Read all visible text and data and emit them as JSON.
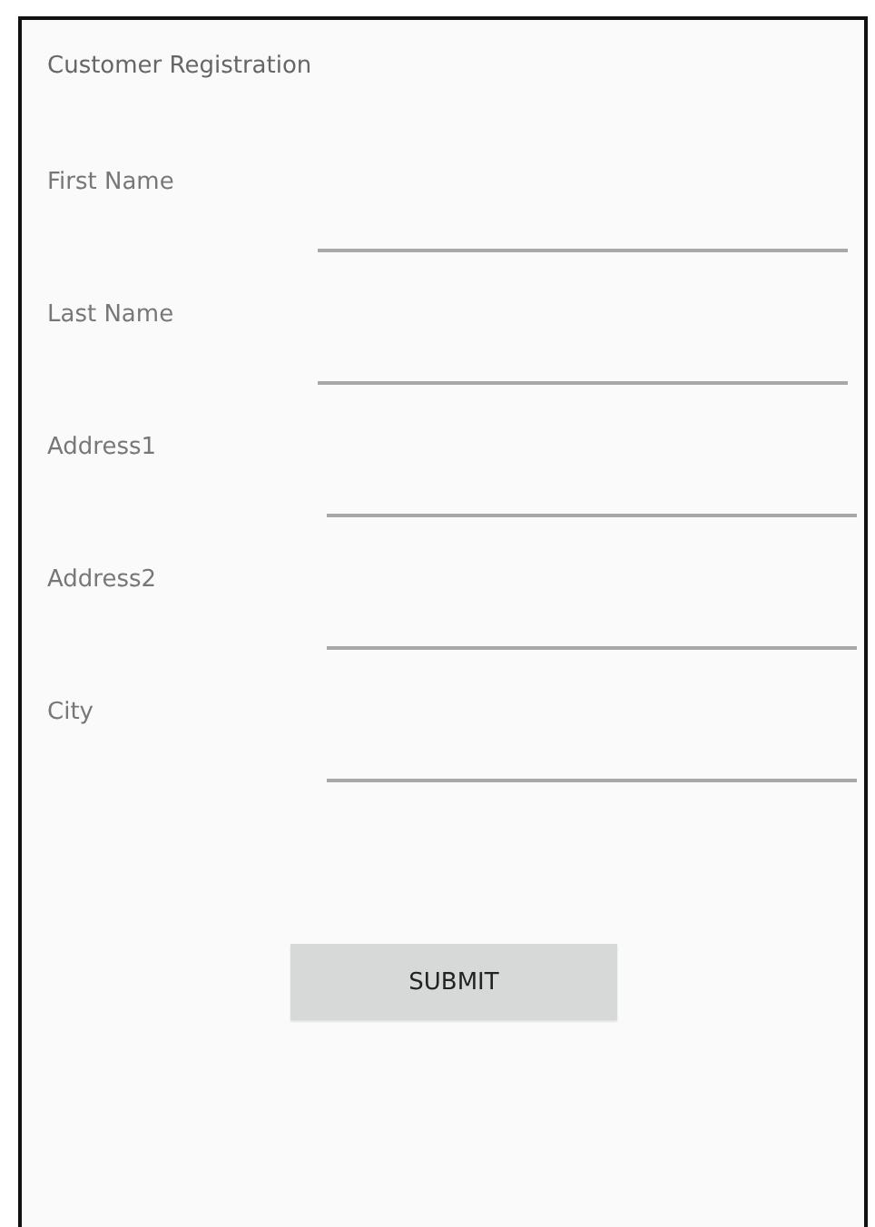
{
  "title": "Customer Registration",
  "fields": [
    {
      "label": "First Name"
    },
    {
      "label": "Last Name"
    },
    {
      "label": "Address1"
    },
    {
      "label": "Address2"
    },
    {
      "label": "City"
    }
  ],
  "button": "SUBMIT"
}
